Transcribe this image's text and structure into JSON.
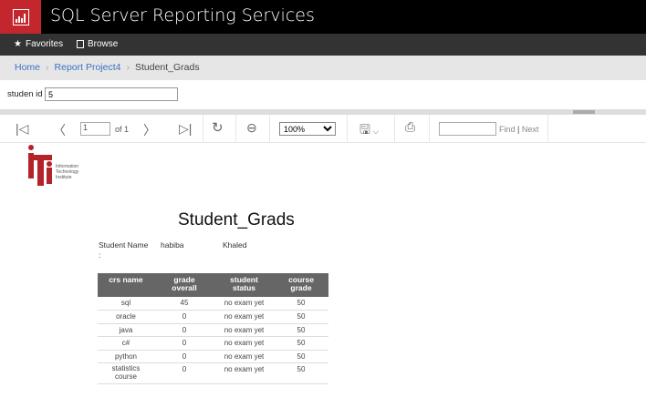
{
  "app": {
    "title": "SQL Server Reporting Services",
    "brand_color": "#c4262e"
  },
  "nav": {
    "favorites": "Favorites",
    "browse": "Browse"
  },
  "breadcrumb": [
    "Home",
    "Report Project4",
    "Student_Grads"
  ],
  "params": {
    "label": "studen id",
    "value": "5"
  },
  "toolbar": {
    "page": "1",
    "of": "of 1",
    "zoom": "100%",
    "find": "Find",
    "sep": "|",
    "next": "Next"
  },
  "report": {
    "logo_text": [
      "Information",
      "Technology",
      "Institute"
    ],
    "title": "Student_Grads",
    "student_label": "Student Name",
    "student_colon": ":",
    "first_name": "habiba",
    "last_name": "Khaled",
    "columns": [
      [
        "crs name",
        ""
      ],
      [
        "grade",
        "overall"
      ],
      [
        "student",
        "status"
      ],
      [
        "course",
        "grade"
      ]
    ],
    "rows": [
      [
        "sql",
        "45",
        "no exam yet",
        "50"
      ],
      [
        "oracle",
        "0",
        "no exam yet",
        "50"
      ],
      [
        "java",
        "0",
        "no exam yet",
        "50"
      ],
      [
        "c#",
        "0",
        "no exam yet",
        "50"
      ],
      [
        "python",
        "0",
        "no exam yet",
        "50"
      ],
      [
        "statistics course",
        "0",
        "no exam yet",
        "50"
      ]
    ]
  }
}
